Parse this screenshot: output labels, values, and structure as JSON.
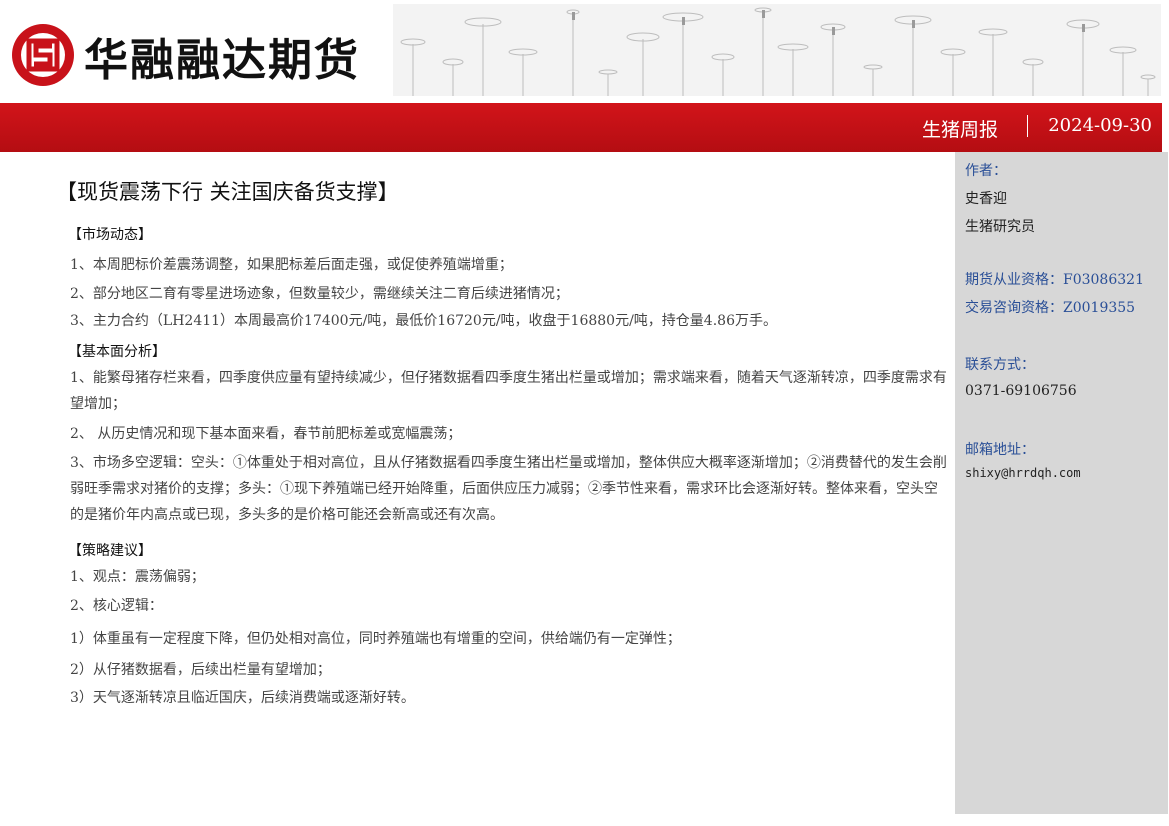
{
  "header": {
    "company_name": "华融融达期货",
    "report_type": "生猪周报",
    "date": "2024-09-30",
    "colors": {
      "brand_red": "#c8121a",
      "sidebar_gray": "#d7d7d7",
      "label_blue": "#2a4f97"
    }
  },
  "main": {
    "headline": "【现货震荡下行 关注国庆备货支撑】",
    "sections": [
      {
        "title": "【市场动态】",
        "paragraphs": [
          "1、本周肥标价差震荡调整，如果肥标差后面走强，或促使养殖端增重；",
          "2、部分地区二育有零星进场迹象，但数量较少，需继续关注二育后续进猪情况；",
          "3、主力合约（LH2411）本周最高价17400元/吨，最低价16720元/吨，收盘于16880元/吨，持仓量4.86万手。"
        ]
      },
      {
        "title": "【基本面分析】",
        "paragraphs": [
          "1、能繁母猪存栏来看，四季度供应量有望持续减少，但仔猪数据看四季度生猪出栏量或增加；需求端来看，随着天气逐渐转凉，四季度需求有望增加；",
          "2、 从历史情况和现下基本面来看，春节前肥标差或宽幅震荡；",
          "3、市场多空逻辑：空头：①体重处于相对高位，且从仔猪数据看四季度生猪出栏量或增加，整体供应大概率逐渐增加；②消费替代的发生会削弱旺季需求对猪价的支撑；多头：①现下养殖端已经开始降重，后面供应压力减弱；②季节性来看，需求环比会逐渐好转。整体来看，空头空的是猪价年内高点或已现，多头多的是价格可能还会新高或还有次高。"
        ]
      },
      {
        "title": "【策略建议】",
        "paragraphs": [
          "1、观点：震荡偏弱；",
          "2、核心逻辑：",
          "1）体重虽有一定程度下降，但仍处相对高位，同时养殖端也有增重的空间，供给端仍有一定弹性；",
          "2）从仔猪数据看，后续出栏量有望增加；",
          "3）天气逐渐转凉且临近国庆，后续消费端或逐渐好转。"
        ]
      }
    ]
  },
  "sidebar": {
    "author_label": "作者：",
    "author_name": "史香迎",
    "author_title": "生猪研究员",
    "futures_qual": "期货从业资格：F03086321",
    "trading_qual": "交易咨询资格：Z0019355",
    "contact_label": "联系方式：",
    "phone": "0371-69106756",
    "email_label": "邮箱地址：",
    "email": "shixy@hrrdqh.com"
  }
}
